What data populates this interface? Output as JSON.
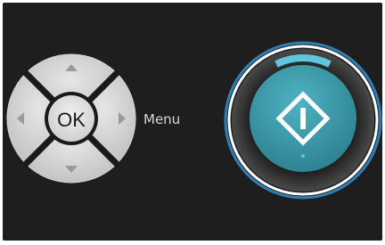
{
  "dpad": {
    "ok_label": "OK",
    "up_icon": "triangle-up-icon",
    "down_icon": "triangle-down-icon",
    "left_icon": "triangle-left-icon",
    "right_icon": "triangle-right-icon"
  },
  "menu_label": "Menu",
  "start_button": {
    "icon": "start-diamond-icon",
    "ring_color": "#2f7fb6",
    "button_color": "#3ea3b4",
    "indicator_color": "#5fc6e0"
  },
  "colors": {
    "panel_background": "#1e1e1e",
    "dpad_face": "#d6d6d6",
    "dpad_separator": "#1a1a1a"
  }
}
